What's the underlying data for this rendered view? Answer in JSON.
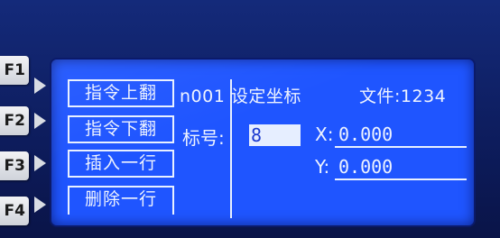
{
  "function_keys": [
    {
      "label": "F1"
    },
    {
      "label": "F2"
    },
    {
      "label": "F3"
    },
    {
      "label": "F4"
    }
  ],
  "menu": {
    "items": [
      {
        "label": "指令上翻"
      },
      {
        "label": "指令下翻"
      },
      {
        "label": "插入一行"
      },
      {
        "label": "删除一行"
      }
    ]
  },
  "header": {
    "program_label": "n001 设定坐标",
    "file_label": "文件:1234"
  },
  "fields": {
    "mark_label": "标号:",
    "mark_value": "8",
    "x_label": "X:",
    "x_value": "0.000",
    "y_label": "Y:",
    "y_value": "0.000"
  },
  "colors": {
    "screen_bg": "#1f55ff",
    "text": "#eef3ff",
    "bezel": "#0e1a58"
  }
}
